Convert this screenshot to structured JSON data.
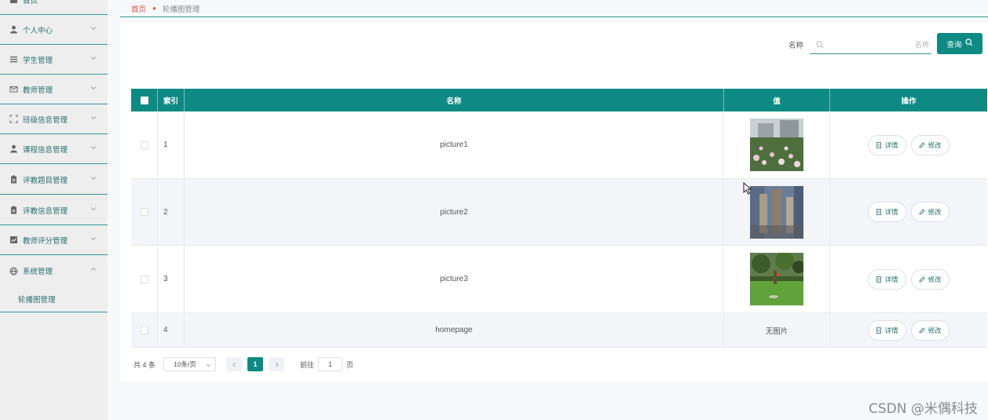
{
  "sidebar": {
    "items": [
      {
        "label": "首页",
        "icon": "home-icon"
      },
      {
        "label": "个人中心",
        "icon": "user-icon"
      },
      {
        "label": "学生管理",
        "icon": "list-icon"
      },
      {
        "label": "教师管理",
        "icon": "mail-icon"
      },
      {
        "label": "班级信息管理",
        "icon": "frame-icon"
      },
      {
        "label": "课程信息管理",
        "icon": "user-icon"
      },
      {
        "label": "评教题目管理",
        "icon": "clipboard-icon"
      },
      {
        "label": "评教信息管理",
        "icon": "clipboard-icon"
      },
      {
        "label": "教师评分管理",
        "icon": "chart-icon"
      },
      {
        "label": "系统管理",
        "icon": "globe-icon"
      }
    ],
    "submenu": {
      "label": "轮播图管理"
    }
  },
  "breadcrumb": {
    "home": "首页",
    "current": "轮播图管理"
  },
  "search": {
    "label": "名称",
    "placeholder": "名称",
    "button_label": "查询"
  },
  "table": {
    "headers": {
      "index": "索引",
      "name": "名称",
      "value": "值",
      "actions": "操作"
    },
    "rows": [
      {
        "index": "1",
        "name": "picture1",
        "value": "",
        "detail": "详情",
        "edit": "修改"
      },
      {
        "index": "2",
        "name": "picture2",
        "value": "",
        "detail": "详情",
        "edit": "修改"
      },
      {
        "index": "3",
        "name": "picture3",
        "value": "",
        "detail": "详情",
        "edit": "修改"
      },
      {
        "index": "4",
        "name": "homepage",
        "value": "无图片",
        "detail": "详情",
        "edit": "修改"
      }
    ]
  },
  "pagination": {
    "total": "共 4 条",
    "page_size": "10条/页",
    "current_page": "1",
    "goto_label": "前往",
    "goto_value": "1",
    "goto_suffix": "页"
  },
  "watermark": "CSDN @米偶科技",
  "colors": {
    "accent": "#0e8a83",
    "breadcrumb_home": "#e0533b"
  }
}
